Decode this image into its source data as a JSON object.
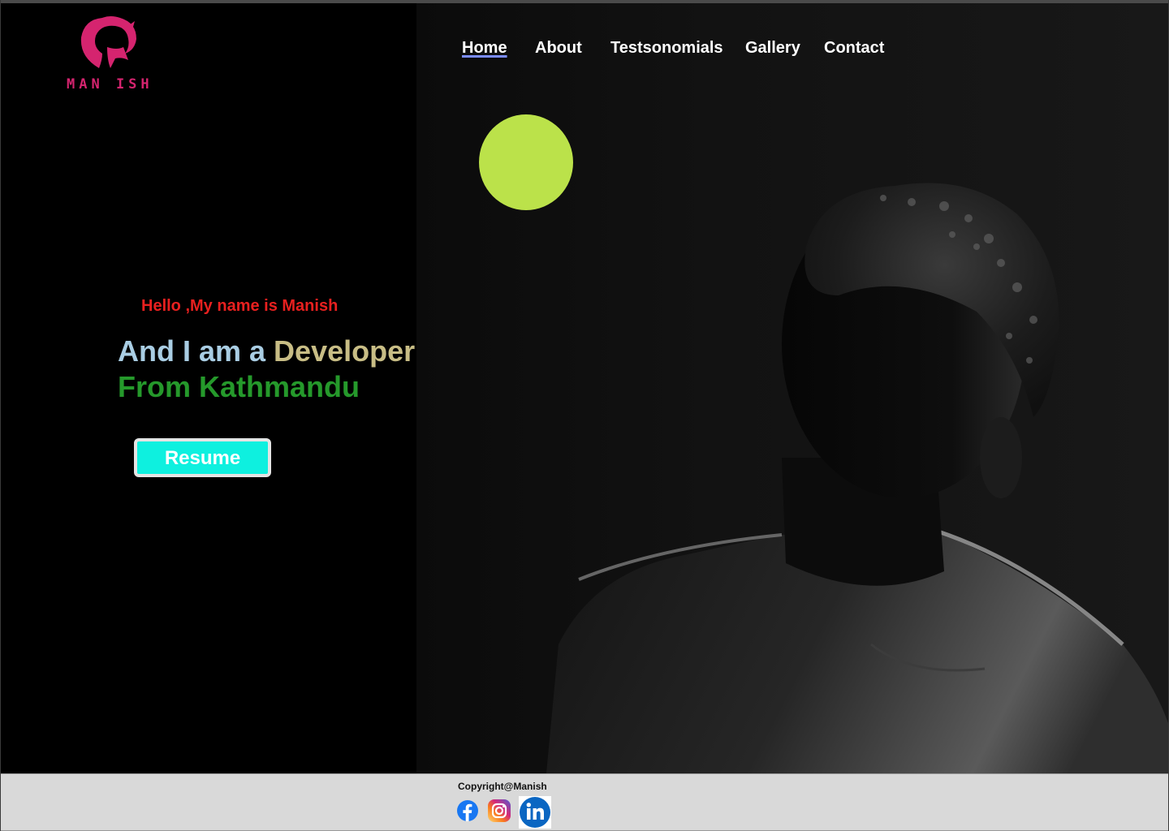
{
  "brand": {
    "logo_text": "MAN ISH",
    "color": "#d5246f"
  },
  "nav": {
    "items": [
      {
        "label": "Home",
        "active": true
      },
      {
        "label": "About",
        "active": false
      },
      {
        "label": "Testsonomials",
        "active": false
      },
      {
        "label": "Gallery",
        "active": false
      },
      {
        "label": "Contact",
        "active": false
      }
    ]
  },
  "hero": {
    "greeting": "Hello ,My name is Manish",
    "headline_prefix": "And I am a ",
    "headline_role": "Developer",
    "headline_location": "From Kathmandu",
    "resume_button": "Resume",
    "accent_color": "#bbe24a",
    "photo": "dark-portrait-man"
  },
  "footer": {
    "copyright": "Copyright@Manish",
    "social": [
      {
        "name": "facebook-icon"
      },
      {
        "name": "instagram-icon"
      },
      {
        "name": "linkedin-icon"
      }
    ]
  },
  "colors": {
    "greeting": "#e8201f",
    "headline_prefix": "#a9cde3",
    "headline_role": "#c8bd85",
    "headline_location": "#25992b",
    "button_bg": "#0ef0df",
    "footer_bg": "#d9d9d9"
  }
}
